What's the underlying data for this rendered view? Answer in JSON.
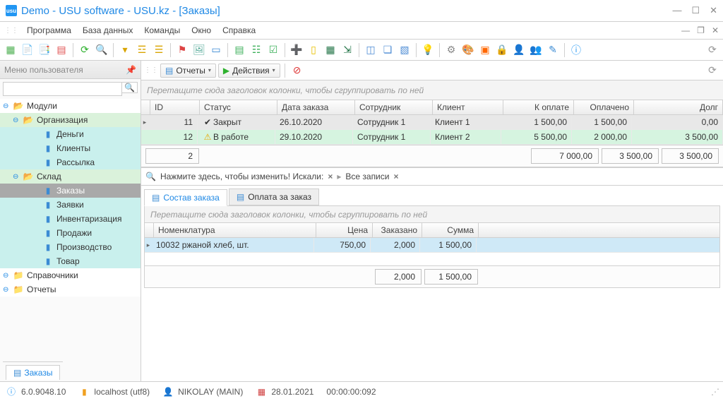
{
  "titlebar": {
    "app_icon_text": "usu",
    "title": "Demo - USU software - USU.kz - [Заказы]"
  },
  "menubar": {
    "items": [
      "Программа",
      "База данных",
      "Команды",
      "Окно",
      "Справка"
    ]
  },
  "left_panel": {
    "title": "Меню пользователя",
    "search_placeholder": "",
    "tree": [
      {
        "label": "Модули",
        "depth": 0,
        "expandable": true,
        "icon": "folder-open"
      },
      {
        "label": "Организация",
        "depth": 1,
        "expandable": true,
        "icon": "folder-open"
      },
      {
        "label": "Деньги",
        "depth": 2,
        "expandable": false,
        "icon": "book"
      },
      {
        "label": "Клиенты",
        "depth": 2,
        "expandable": false,
        "icon": "book"
      },
      {
        "label": "Рассылка",
        "depth": 2,
        "expandable": false,
        "icon": "book"
      },
      {
        "label": "Склад",
        "depth": 1,
        "expandable": true,
        "icon": "folder-open"
      },
      {
        "label": "Заказы",
        "depth": 2,
        "expandable": false,
        "icon": "book",
        "selected": true
      },
      {
        "label": "Заявки",
        "depth": 2,
        "expandable": false,
        "icon": "book"
      },
      {
        "label": "Инвентаризация",
        "depth": 2,
        "expandable": false,
        "icon": "book"
      },
      {
        "label": "Продажи",
        "depth": 2,
        "expandable": false,
        "icon": "book"
      },
      {
        "label": "Производство",
        "depth": 2,
        "expandable": false,
        "icon": "book"
      },
      {
        "label": "Товар",
        "depth": 2,
        "expandable": false,
        "icon": "book"
      },
      {
        "label": "Справочники",
        "depth": 0,
        "expandable": true,
        "icon": "folder"
      },
      {
        "label": "Отчеты",
        "depth": 0,
        "expandable": true,
        "icon": "folder"
      }
    ],
    "tab": "Заказы"
  },
  "main": {
    "toolbar": {
      "reports": "Отчеты",
      "actions": "Действия"
    },
    "group_hint": "Перетащите сюда заголовок колонки, чтобы сгруппировать по ней",
    "grid": {
      "columns": [
        "ID",
        "Статус",
        "Дата заказа",
        "Сотрудник",
        "Клиент",
        "К оплате",
        "Оплачено",
        "Долг"
      ],
      "rows": [
        {
          "id": "11",
          "status_icon": "check",
          "status": "Закрыт",
          "date": "26.10.2020",
          "emp": "Сотрудник 1",
          "client": "Клиент 1",
          "pay": "1 500,00",
          "paid": "1 500,00",
          "debt": "0,00",
          "sel": true
        },
        {
          "id": "12",
          "status_icon": "warn",
          "status": "В работе",
          "date": "29.10.2020",
          "emp": "Сотрудник 1",
          "client": "Клиент 2",
          "pay": "5 500,00",
          "paid": "2 000,00",
          "debt": "3 500,00",
          "sel": false
        }
      ],
      "footer": {
        "count": "2",
        "pay": "7 000,00",
        "paid": "3 500,00",
        "debt": "3 500,00"
      }
    },
    "filterbar": {
      "hint": "Нажмите здесь, чтобы изменить! Искали:",
      "chip": "Все записи"
    },
    "tabs": {
      "t1": "Состав заказа",
      "t2": "Оплата за заказ"
    },
    "detail": {
      "group_hint": "Перетащите сюда заголовок колонки, чтобы сгруппировать по ней",
      "columns": [
        "Номенклатура",
        "Цена",
        "Заказано",
        "Сумма"
      ],
      "row": {
        "nom": "10032 ржаной хлеб, шт.",
        "price": "750,00",
        "qty": "2,000",
        "sum": "1 500,00"
      },
      "footer": {
        "qty": "2,000",
        "sum": "1 500,00"
      }
    }
  },
  "status": {
    "version": "6.0.9048.10",
    "host": "localhost (utf8)",
    "user": "NIKOLAY (MAIN)",
    "date": "28.01.2021",
    "time": "00:00:00:092"
  }
}
